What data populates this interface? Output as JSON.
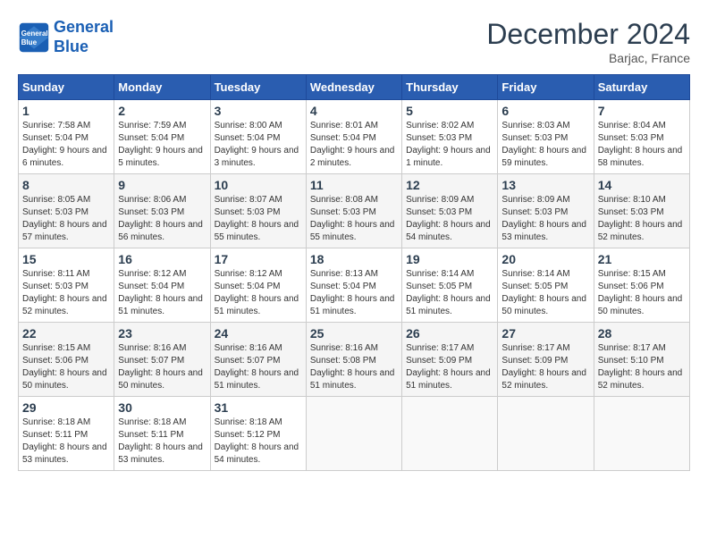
{
  "header": {
    "logo_line1": "General",
    "logo_line2": "Blue",
    "month_title": "December 2024",
    "location": "Barjac, France"
  },
  "weekdays": [
    "Sunday",
    "Monday",
    "Tuesday",
    "Wednesday",
    "Thursday",
    "Friday",
    "Saturday"
  ],
  "weeks": [
    [
      {
        "day": "1",
        "sunrise": "Sunrise: 7:58 AM",
        "sunset": "Sunset: 5:04 PM",
        "daylight": "Daylight: 9 hours and 6 minutes."
      },
      {
        "day": "2",
        "sunrise": "Sunrise: 7:59 AM",
        "sunset": "Sunset: 5:04 PM",
        "daylight": "Daylight: 9 hours and 5 minutes."
      },
      {
        "day": "3",
        "sunrise": "Sunrise: 8:00 AM",
        "sunset": "Sunset: 5:04 PM",
        "daylight": "Daylight: 9 hours and 3 minutes."
      },
      {
        "day": "4",
        "sunrise": "Sunrise: 8:01 AM",
        "sunset": "Sunset: 5:04 PM",
        "daylight": "Daylight: 9 hours and 2 minutes."
      },
      {
        "day": "5",
        "sunrise": "Sunrise: 8:02 AM",
        "sunset": "Sunset: 5:03 PM",
        "daylight": "Daylight: 9 hours and 1 minute."
      },
      {
        "day": "6",
        "sunrise": "Sunrise: 8:03 AM",
        "sunset": "Sunset: 5:03 PM",
        "daylight": "Daylight: 8 hours and 59 minutes."
      },
      {
        "day": "7",
        "sunrise": "Sunrise: 8:04 AM",
        "sunset": "Sunset: 5:03 PM",
        "daylight": "Daylight: 8 hours and 58 minutes."
      }
    ],
    [
      {
        "day": "8",
        "sunrise": "Sunrise: 8:05 AM",
        "sunset": "Sunset: 5:03 PM",
        "daylight": "Daylight: 8 hours and 57 minutes."
      },
      {
        "day": "9",
        "sunrise": "Sunrise: 8:06 AM",
        "sunset": "Sunset: 5:03 PM",
        "daylight": "Daylight: 8 hours and 56 minutes."
      },
      {
        "day": "10",
        "sunrise": "Sunrise: 8:07 AM",
        "sunset": "Sunset: 5:03 PM",
        "daylight": "Daylight: 8 hours and 55 minutes."
      },
      {
        "day": "11",
        "sunrise": "Sunrise: 8:08 AM",
        "sunset": "Sunset: 5:03 PM",
        "daylight": "Daylight: 8 hours and 55 minutes."
      },
      {
        "day": "12",
        "sunrise": "Sunrise: 8:09 AM",
        "sunset": "Sunset: 5:03 PM",
        "daylight": "Daylight: 8 hours and 54 minutes."
      },
      {
        "day": "13",
        "sunrise": "Sunrise: 8:09 AM",
        "sunset": "Sunset: 5:03 PM",
        "daylight": "Daylight: 8 hours and 53 minutes."
      },
      {
        "day": "14",
        "sunrise": "Sunrise: 8:10 AM",
        "sunset": "Sunset: 5:03 PM",
        "daylight": "Daylight: 8 hours and 52 minutes."
      }
    ],
    [
      {
        "day": "15",
        "sunrise": "Sunrise: 8:11 AM",
        "sunset": "Sunset: 5:03 PM",
        "daylight": "Daylight: 8 hours and 52 minutes."
      },
      {
        "day": "16",
        "sunrise": "Sunrise: 8:12 AM",
        "sunset": "Sunset: 5:04 PM",
        "daylight": "Daylight: 8 hours and 51 minutes."
      },
      {
        "day": "17",
        "sunrise": "Sunrise: 8:12 AM",
        "sunset": "Sunset: 5:04 PM",
        "daylight": "Daylight: 8 hours and 51 minutes."
      },
      {
        "day": "18",
        "sunrise": "Sunrise: 8:13 AM",
        "sunset": "Sunset: 5:04 PM",
        "daylight": "Daylight: 8 hours and 51 minutes."
      },
      {
        "day": "19",
        "sunrise": "Sunrise: 8:14 AM",
        "sunset": "Sunset: 5:05 PM",
        "daylight": "Daylight: 8 hours and 51 minutes."
      },
      {
        "day": "20",
        "sunrise": "Sunrise: 8:14 AM",
        "sunset": "Sunset: 5:05 PM",
        "daylight": "Daylight: 8 hours and 50 minutes."
      },
      {
        "day": "21",
        "sunrise": "Sunrise: 8:15 AM",
        "sunset": "Sunset: 5:06 PM",
        "daylight": "Daylight: 8 hours and 50 minutes."
      }
    ],
    [
      {
        "day": "22",
        "sunrise": "Sunrise: 8:15 AM",
        "sunset": "Sunset: 5:06 PM",
        "daylight": "Daylight: 8 hours and 50 minutes."
      },
      {
        "day": "23",
        "sunrise": "Sunrise: 8:16 AM",
        "sunset": "Sunset: 5:07 PM",
        "daylight": "Daylight: 8 hours and 50 minutes."
      },
      {
        "day": "24",
        "sunrise": "Sunrise: 8:16 AM",
        "sunset": "Sunset: 5:07 PM",
        "daylight": "Daylight: 8 hours and 51 minutes."
      },
      {
        "day": "25",
        "sunrise": "Sunrise: 8:16 AM",
        "sunset": "Sunset: 5:08 PM",
        "daylight": "Daylight: 8 hours and 51 minutes."
      },
      {
        "day": "26",
        "sunrise": "Sunrise: 8:17 AM",
        "sunset": "Sunset: 5:09 PM",
        "daylight": "Daylight: 8 hours and 51 minutes."
      },
      {
        "day": "27",
        "sunrise": "Sunrise: 8:17 AM",
        "sunset": "Sunset: 5:09 PM",
        "daylight": "Daylight: 8 hours and 52 minutes."
      },
      {
        "day": "28",
        "sunrise": "Sunrise: 8:17 AM",
        "sunset": "Sunset: 5:10 PM",
        "daylight": "Daylight: 8 hours and 52 minutes."
      }
    ],
    [
      {
        "day": "29",
        "sunrise": "Sunrise: 8:18 AM",
        "sunset": "Sunset: 5:11 PM",
        "daylight": "Daylight: 8 hours and 53 minutes."
      },
      {
        "day": "30",
        "sunrise": "Sunrise: 8:18 AM",
        "sunset": "Sunset: 5:11 PM",
        "daylight": "Daylight: 8 hours and 53 minutes."
      },
      {
        "day": "31",
        "sunrise": "Sunrise: 8:18 AM",
        "sunset": "Sunset: 5:12 PM",
        "daylight": "Daylight: 8 hours and 54 minutes."
      },
      null,
      null,
      null,
      null
    ]
  ]
}
